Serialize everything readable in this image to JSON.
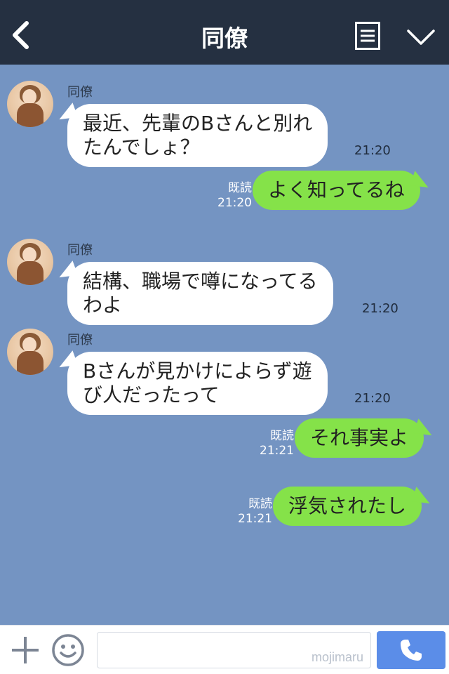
{
  "header": {
    "title": "同僚",
    "back_icon": "chevron-left-icon",
    "menu_icon": "menu-lines-icon",
    "expand_icon": "chevron-down-icon"
  },
  "messages": [
    {
      "type": "in",
      "sender": "同僚",
      "lines": [
        "最近、先輩のBさんと別れ",
        "たんでしょ？"
      ],
      "time": "21:20"
    },
    {
      "type": "out",
      "read": "既読",
      "time": "21:20",
      "text": "よく知ってるね"
    },
    {
      "type": "in",
      "sender": "同僚",
      "lines": [
        "結構、職場で噂になってる",
        "わよ"
      ],
      "time": "21:20"
    },
    {
      "type": "in",
      "sender": "同僚",
      "lines": [
        "Bさんが見かけによらず遊",
        "び人だったって"
      ],
      "time": "21:20"
    },
    {
      "type": "out",
      "read": "既読",
      "time": "21:21",
      "text": "それ事実よ"
    },
    {
      "type": "out",
      "read": "既読",
      "time": "21:21",
      "text": "浮気されたし"
    }
  ],
  "footer": {
    "plus_icon": "plus-icon",
    "emoji_icon": "smiley-icon",
    "input_placeholder": "",
    "watermark": "mojimaru",
    "call_icon": "phone-icon"
  },
  "colors": {
    "header_bg": "#253041",
    "chat_bg": "#7494c2",
    "bubble_out": "#85e249",
    "bubble_in": "#ffffff",
    "call_button": "#5b8de8"
  }
}
